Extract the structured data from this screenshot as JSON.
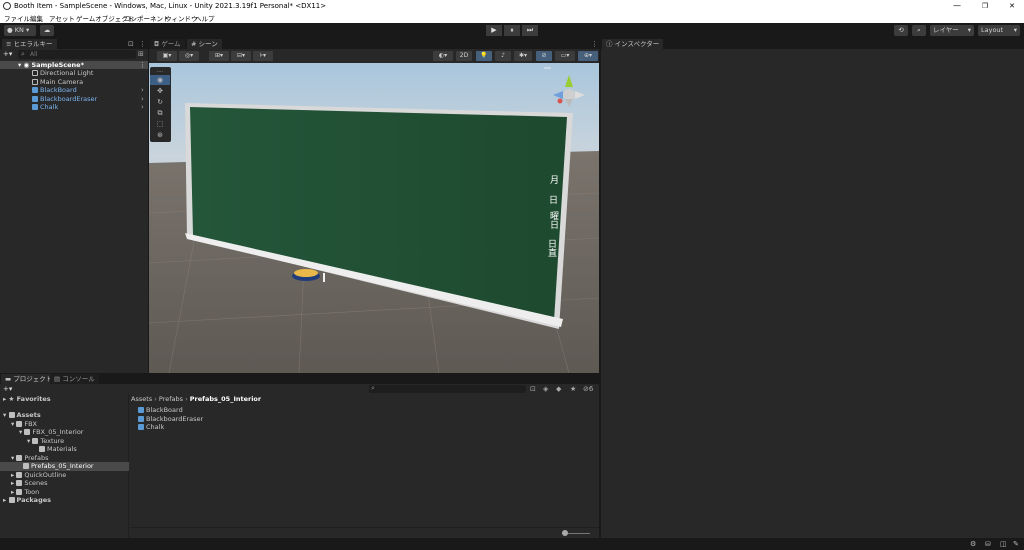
{
  "window": {
    "title": "Booth Item - SampleScene - Windows, Mac, Linux - Unity 2021.3.19f1 Personal* <DX11>",
    "minimize": "—",
    "maximize": "❐",
    "close": "✕"
  },
  "menu": [
    "ファイル",
    "編集",
    "アセット",
    "ゲームオブジェクト",
    "コンポーネント",
    "ウィンドウ",
    "ヘルプ"
  ],
  "toolbar": {
    "account": "KN",
    "cloud_icon": "cloud-icon",
    "play": "▶",
    "pause": "⏸",
    "step": "⏭",
    "layers": "レイヤー",
    "layout": "Layout"
  },
  "hierarchy": {
    "tab": "ヒエラルキー",
    "add": "+▾",
    "search_placeholder": "All",
    "items": [
      {
        "label": "SampleScene*",
        "type": "scene"
      },
      {
        "label": "Directional Light",
        "type": "object"
      },
      {
        "label": "Main Camera",
        "type": "object"
      },
      {
        "label": "BlackBoard",
        "type": "prefab"
      },
      {
        "label": "BlackboardEraser",
        "type": "prefab"
      },
      {
        "label": "Chalk",
        "type": "prefab"
      }
    ]
  },
  "scene_tabs": {
    "game": "ゲーム",
    "scene": "シーン"
  },
  "scene_toolbar": {
    "mode_2d": "2D"
  },
  "blackboard_text": [
    "月",
    "日",
    "曜日",
    "日直"
  ],
  "inspector": {
    "tab": "インスペクター"
  },
  "project": {
    "tab_project": "プロジェクト",
    "tab_console": "コンソール",
    "add": "+▾",
    "hidden_count": "6",
    "tree": [
      {
        "label": "Favorites",
        "level": 0,
        "bold": true
      },
      {
        "label": "Assets",
        "level": 0,
        "bold": true
      },
      {
        "label": "FBX",
        "level": 1
      },
      {
        "label": "FBX_05_Interior",
        "level": 2
      },
      {
        "label": "Texture",
        "level": 3
      },
      {
        "label": "Materials",
        "level": 4
      },
      {
        "label": "Prefabs",
        "level": 1
      },
      {
        "label": "Prefabs_05_Interior",
        "level": 2,
        "selected": true
      },
      {
        "label": "QuickOutline",
        "level": 1
      },
      {
        "label": "Scenes",
        "level": 1
      },
      {
        "label": "Toon",
        "level": 1
      },
      {
        "label": "Packages",
        "level": 0,
        "bold": true
      }
    ],
    "breadcrumb": [
      "Assets",
      "Prefabs",
      "Prefabs_05_Interior"
    ],
    "files": [
      "BlackBoard",
      "BlackboardEraser",
      "Chalk"
    ]
  },
  "colors": {
    "accent": "#2c5d87",
    "prefab_text": "#7cb4f0",
    "board": "#1f4a2e"
  }
}
